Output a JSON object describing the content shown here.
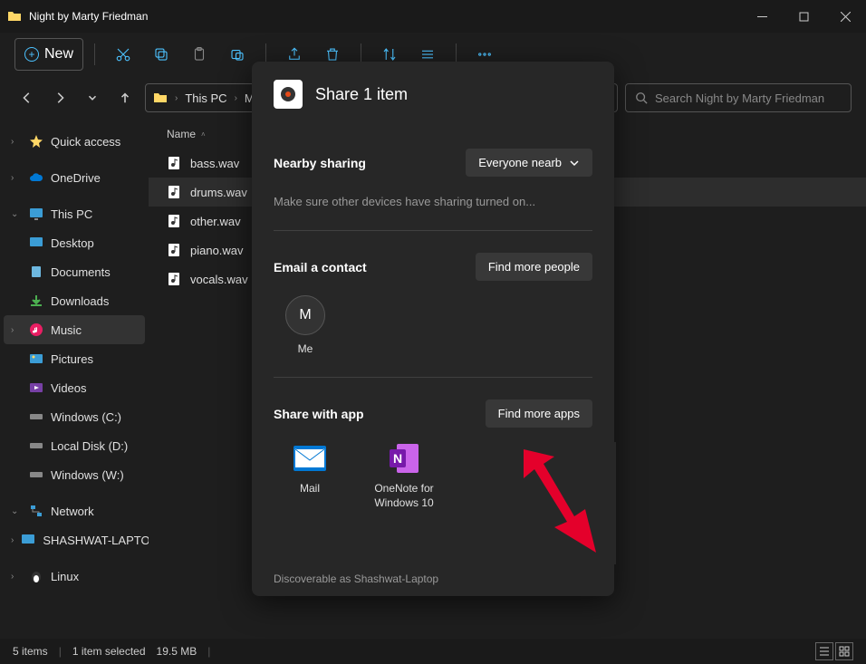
{
  "titlebar": {
    "title": "Night by Marty Friedman"
  },
  "toolbar": {
    "new_label": "New"
  },
  "breadcrumbs": [
    "This PC",
    "Music"
  ],
  "search": {
    "placeholder": "Search Night by Marty Friedman"
  },
  "sidebar": {
    "quick": "Quick access",
    "onedrive": "OneDrive",
    "thispc": "This PC",
    "desktop": "Desktop",
    "documents": "Documents",
    "downloads": "Downloads",
    "music": "Music",
    "pictures": "Pictures",
    "videos": "Videos",
    "windowsc": "Windows (C:)",
    "locald": "Local Disk (D:)",
    "windowsw": "Windows (W:)",
    "network": "Network",
    "netpc": "SHASHWAT-LAPTOP",
    "linux": "Linux"
  },
  "columns": {
    "name": "Name"
  },
  "files": [
    "bass.wav",
    "drums.wav",
    "other.wav",
    "piano.wav",
    "vocals.wav"
  ],
  "share": {
    "title": "Share 1 item",
    "nearby_label": "Nearby sharing",
    "nearby_btn": "Everyone nearb",
    "nearby_hint": "Make sure other devices have sharing turned on...",
    "email_label": "Email a contact",
    "email_btn": "Find more people",
    "contact_initial": "M",
    "contact_name": "Me",
    "app_label": "Share with app",
    "app_btn": "Find more apps",
    "apps": [
      {
        "name": "Mail"
      },
      {
        "name": "OneNote for Windows 10"
      }
    ],
    "discoverable": "Discoverable as Shashwat-Laptop"
  },
  "status": {
    "count": "5 items",
    "selected": "1 item selected",
    "size": "19.5 MB"
  }
}
